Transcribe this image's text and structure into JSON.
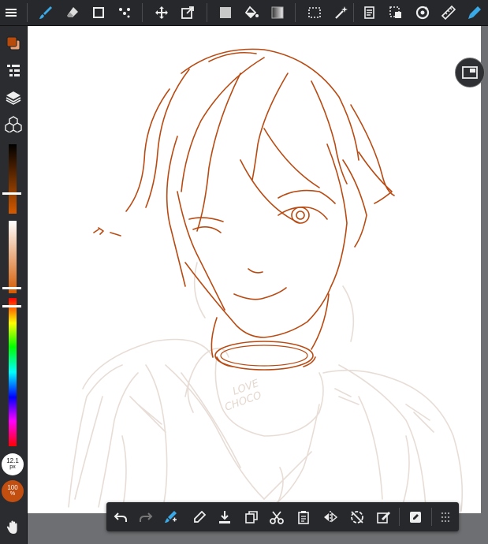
{
  "toolbar": {
    "tools": [
      {
        "id": "menu",
        "icon": "menu-icon"
      },
      {
        "id": "brush",
        "icon": "brush-icon",
        "active": true
      },
      {
        "id": "eraser",
        "icon": "eraser-icon"
      },
      {
        "id": "rect-select",
        "icon": "rectangle-icon"
      },
      {
        "id": "dot",
        "icon": "dot-tool-icon"
      },
      {
        "id": "move",
        "icon": "move-icon"
      },
      {
        "id": "transform",
        "icon": "transform-icon"
      },
      {
        "id": "fill-color",
        "icon": "fill-color-icon"
      },
      {
        "id": "bucket",
        "icon": "bucket-icon"
      },
      {
        "id": "gradient",
        "icon": "gradient-icon"
      },
      {
        "id": "select",
        "icon": "selection-icon"
      },
      {
        "id": "magic-wand",
        "icon": "magic-wand-icon"
      },
      {
        "id": "copy",
        "icon": "copy-layer-icon"
      },
      {
        "id": "select-layer",
        "icon": "select-layer-icon"
      },
      {
        "id": "rotate",
        "icon": "rotate-icon"
      },
      {
        "id": "ruler",
        "icon": "ruler-icon"
      },
      {
        "id": "pen",
        "icon": "pen-icon"
      }
    ]
  },
  "sidebar": {
    "primary_color": "#b84a0c",
    "secondary_color": "#e8a37a",
    "brush_size": "12.1",
    "brush_unit": "px",
    "opacity": "100",
    "opacity_unit": "%",
    "hand_icon": "hand-icon"
  },
  "sketch": {
    "ink_color": "#b94a12",
    "rough_color": "#e7ddd6",
    "cup_text_1": "LOVE",
    "cup_text_2": "CHOCO"
  },
  "bottom_actions": [
    {
      "id": "undo",
      "icon": "undo-icon"
    },
    {
      "id": "redo",
      "icon": "redo-icon"
    },
    {
      "id": "brush-tool",
      "icon": "brush-tool-icon"
    },
    {
      "id": "eyedropper",
      "icon": "eyedropper-icon"
    },
    {
      "id": "save",
      "icon": "download-icon"
    },
    {
      "id": "duplicate",
      "icon": "duplicate-icon"
    },
    {
      "id": "cut",
      "icon": "scissors-icon"
    },
    {
      "id": "paste",
      "icon": "paste-icon"
    },
    {
      "id": "flip",
      "icon": "flip-icon"
    },
    {
      "id": "no-rotate",
      "icon": "rotate-off-icon"
    },
    {
      "id": "clear",
      "icon": "clear-icon"
    },
    {
      "id": "edit",
      "icon": "edit-icon"
    },
    {
      "id": "more",
      "icon": "grid-dots-icon"
    }
  ]
}
